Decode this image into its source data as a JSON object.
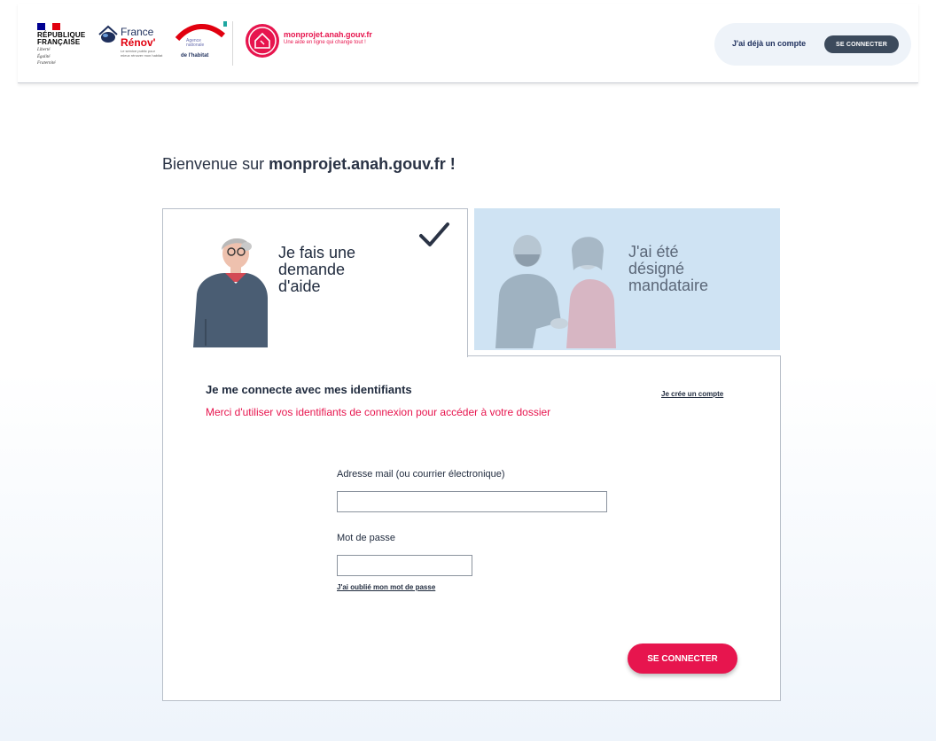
{
  "header": {
    "rf_title_line1": "RÉPUBLIQUE",
    "rf_title_line2": "FRANÇAISE",
    "rf_motto_1": "Liberté",
    "rf_motto_2": "Égalité",
    "rf_motto_3": "Fraternité",
    "france_renov_line1": "France",
    "france_renov_line2": "Rénov'",
    "france_renov_tagline": "Le service public pour mieux rénover mon habitat",
    "anah_line1": "Agence",
    "anah_line2": "nationale",
    "anah_line3": "de l'habitat",
    "site_name": "monprojet.anah.gouv.fr",
    "site_tagline": "Une aide en ligne qui change tout !",
    "account_text": "J'ai déjà un compte",
    "account_button": "SE CONNECTER"
  },
  "main": {
    "welcome_prefix": "Bienvenue sur ",
    "welcome_site": "monprojet.anah.gouv.fr !",
    "tabs": [
      {
        "line1": "Je fais une",
        "line2": "demande",
        "line3": "d'aide"
      },
      {
        "line1": "J'ai été",
        "line2": "désigné",
        "line3": "mandataire"
      }
    ]
  },
  "panel": {
    "title": "Je me connecte avec mes identifiants",
    "subtitle": "Merci d'utiliser vos identifiants de connexion pour accéder à votre dossier",
    "create_account": "Je crée un compte",
    "email_label": "Adresse mail (ou courrier électronique)",
    "email_value": "",
    "password_label": "Mot de passe",
    "password_value": "",
    "forgot_password": "J'ai oublié mon mot de passe",
    "submit_label": "SE CONNECTER"
  },
  "colors": {
    "accent": "#e7154e",
    "navy": "#1e2f5c",
    "tab_inactive_bg": "#cfe3f3"
  }
}
